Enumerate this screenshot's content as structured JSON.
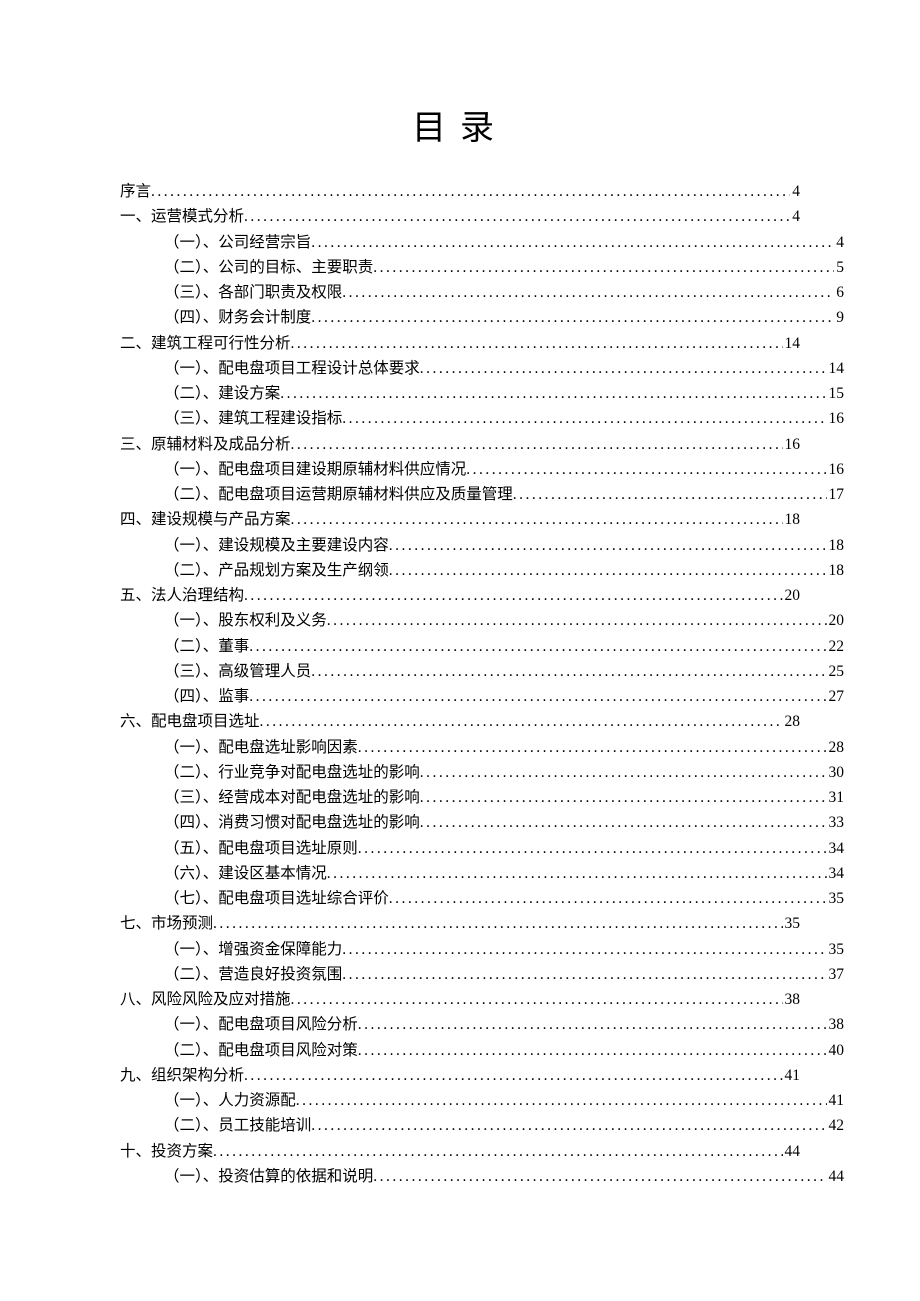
{
  "title": "目录",
  "entries": [
    {
      "level": 0,
      "label": "序言",
      "page": "4"
    },
    {
      "level": 0,
      "label": "一、运营模式分析",
      "page": "4"
    },
    {
      "level": 1,
      "label": "（一）、公司经营宗旨",
      "page": "4"
    },
    {
      "level": 1,
      "label": "（二）、公司的目标、主要职责",
      "page": "5"
    },
    {
      "level": 1,
      "label": "（三）、各部门职责及权限",
      "page": "6"
    },
    {
      "level": 1,
      "label": "（四）、财务会计制度",
      "page": "9"
    },
    {
      "level": 0,
      "label": "二、建筑工程可行性分析",
      "page": "14"
    },
    {
      "level": 1,
      "label": "（一）、配电盘项目工程设计总体要求",
      "page": "14"
    },
    {
      "level": 1,
      "label": "（二）、建设方案",
      "page": "15"
    },
    {
      "level": 1,
      "label": "（三）、建筑工程建设指标",
      "page": "16"
    },
    {
      "level": 0,
      "label": "三、原辅材料及成品分析",
      "page": "16"
    },
    {
      "level": 1,
      "label": "（一）、配电盘项目建设期原辅材料供应情况",
      "page": "16"
    },
    {
      "level": 1,
      "label": "（二）、配电盘项目运营期原辅材料供应及质量管理",
      "page": "17"
    },
    {
      "level": 0,
      "label": "四、建设规模与产品方案",
      "page": "18"
    },
    {
      "level": 1,
      "label": "（一）、建设规模及主要建设内容",
      "page": "18"
    },
    {
      "level": 1,
      "label": "（二）、产品规划方案及生产纲领",
      "page": "18"
    },
    {
      "level": 0,
      "label": "五、法人治理结构",
      "page": "20"
    },
    {
      "level": 1,
      "label": "（一）、股东权利及义务",
      "page": "20"
    },
    {
      "level": 1,
      "label": "（二）、董事",
      "page": "22"
    },
    {
      "level": 1,
      "label": "（三）、高级管理人员",
      "page": "25"
    },
    {
      "level": 1,
      "label": "（四）、监事",
      "page": "27"
    },
    {
      "level": 0,
      "label": "六、配电盘项目选址",
      "page": "28"
    },
    {
      "level": 1,
      "label": "（一）、配电盘选址影响因素",
      "page": "28"
    },
    {
      "level": 1,
      "label": "（二）、行业竞争对配电盘选址的影响",
      "page": "30"
    },
    {
      "level": 1,
      "label": "（三）、经营成本对配电盘选址的影响",
      "page": "31"
    },
    {
      "level": 1,
      "label": "（四）、消费习惯对配电盘选址的影响",
      "page": "33"
    },
    {
      "level": 1,
      "label": "（五）、配电盘项目选址原则",
      "page": "34"
    },
    {
      "level": 1,
      "label": "（六）、建设区基本情况",
      "page": "34"
    },
    {
      "level": 1,
      "label": "（七）、配电盘项目选址综合评价",
      "page": "35"
    },
    {
      "level": 0,
      "label": "七、市场预测",
      "page": "35"
    },
    {
      "level": 1,
      "label": "（一）、增强资金保障能力",
      "page": "35"
    },
    {
      "level": 1,
      "label": "（二）、营造良好投资氛围",
      "page": "37"
    },
    {
      "level": 0,
      "label": "八、风险风险及应对措施",
      "page": "38"
    },
    {
      "level": 1,
      "label": "（一）、配电盘项目风险分析",
      "page": "38"
    },
    {
      "level": 1,
      "label": "（二）、配电盘项目风险对策",
      "page": "40"
    },
    {
      "level": 0,
      "label": "九、组织架构分析",
      "page": "41"
    },
    {
      "level": 1,
      "label": "（一）、人力资源配",
      "page": "41"
    },
    {
      "level": 1,
      "label": "（二）、员工技能培训",
      "page": "42"
    },
    {
      "level": 0,
      "label": "十、投资方案",
      "page": "44"
    },
    {
      "level": 1,
      "label": "（一）、投资估算的依据和说明",
      "page": "44"
    }
  ]
}
